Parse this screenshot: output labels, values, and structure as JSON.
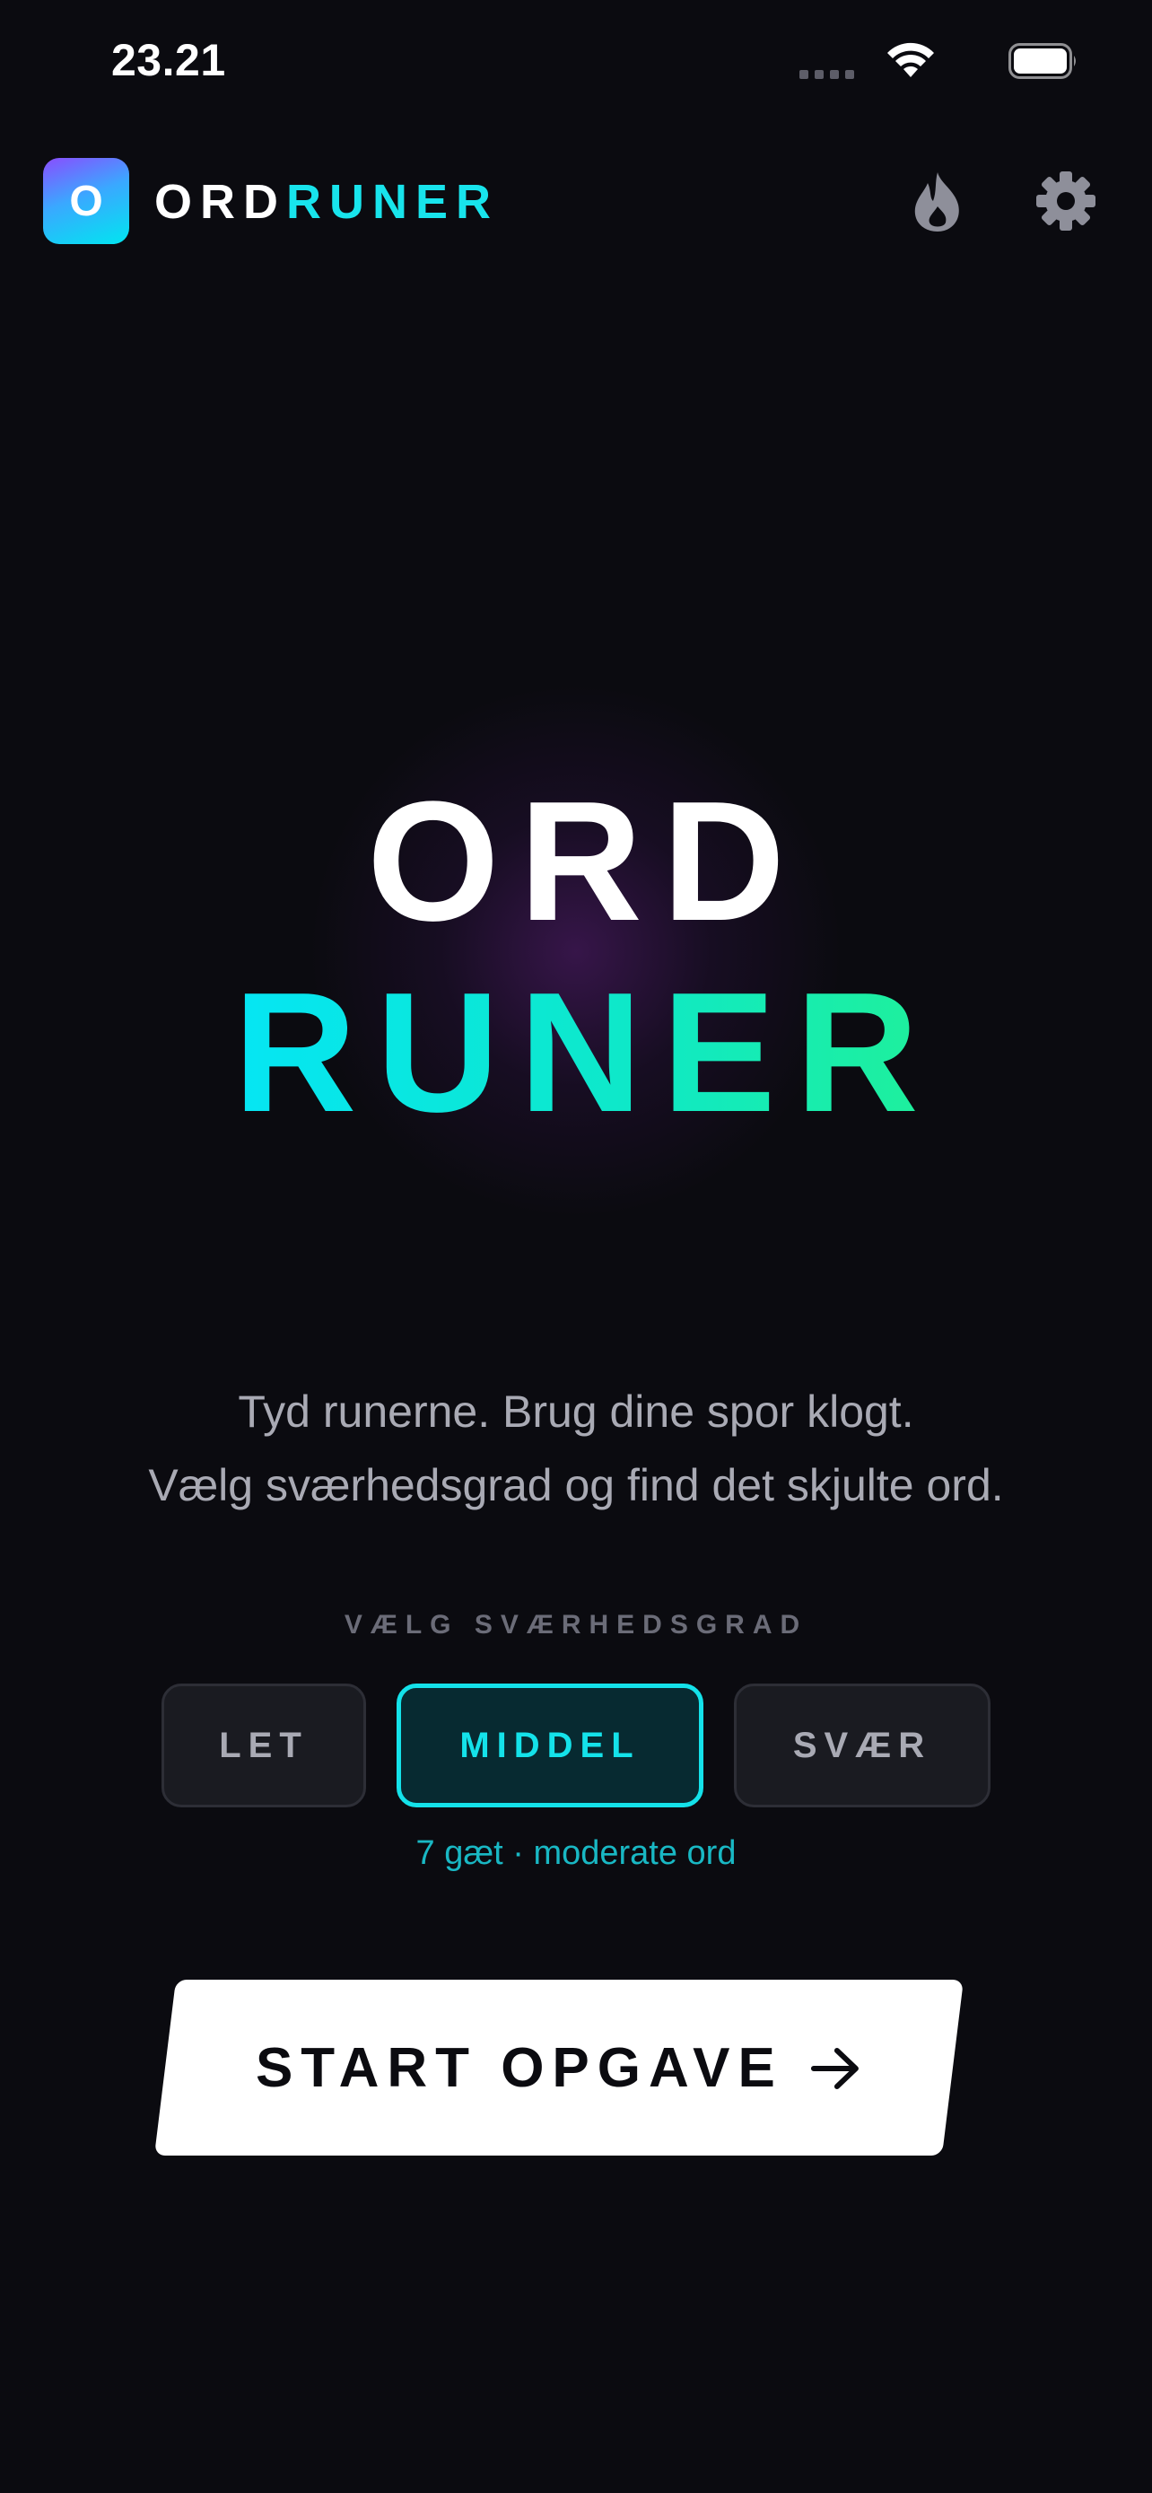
{
  "status_bar": {
    "time": "23.21",
    "icons": [
      "cellular-signal-icon",
      "wifi-icon",
      "battery-icon"
    ]
  },
  "header": {
    "logo_letter": "O",
    "brand_part1": "ORD",
    "brand_part2": "RUNER",
    "actions": [
      "flame-icon",
      "gear-icon"
    ]
  },
  "hero": {
    "line1": "ORD",
    "line2": "RUNER"
  },
  "tagline": {
    "line1": "Tyd runerne. Brug dine spor klogt.",
    "line2": "Vælg sværhedsgrad og find det skjulte ord."
  },
  "difficulty": {
    "label": "VÆLG SVÆRHEDSGRAD",
    "options": [
      "LET",
      "MIDDEL",
      "SVÆR"
    ],
    "selected": "MIDDEL",
    "hint": "7 gæt · moderate ord"
  },
  "start": {
    "label": "START OPGAVE",
    "icon": "arrow-right-icon"
  },
  "colors": {
    "background": "#0b0b10",
    "accent": "#14e2ea",
    "accent_green": "#1ff09a",
    "muted_text": "#a9aab4"
  }
}
